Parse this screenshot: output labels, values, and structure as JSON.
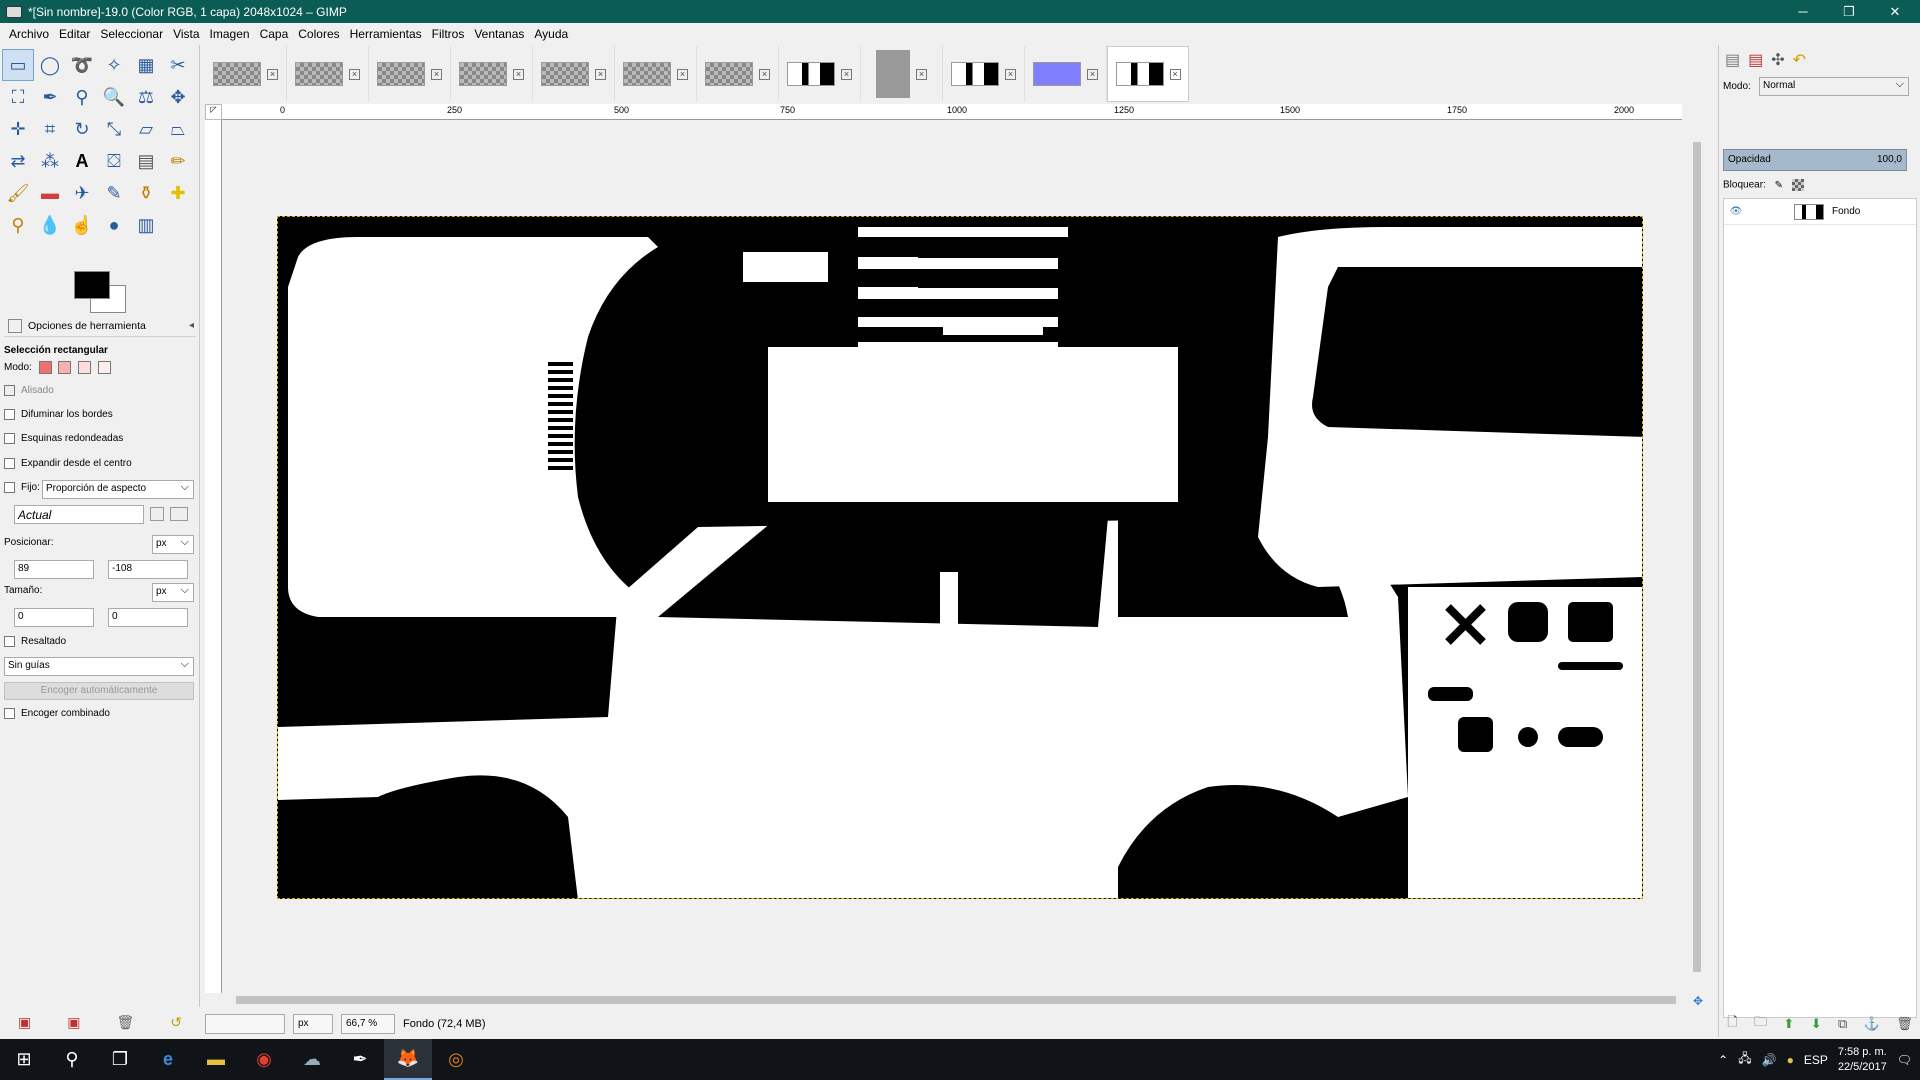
{
  "window": {
    "title": "*[Sin nombre]-19.0 (Color RGB, 1 capa) 2048x1024 – GIMP"
  },
  "menu": [
    "Archivo",
    "Editar",
    "Seleccionar",
    "Vista",
    "Imagen",
    "Capa",
    "Colores",
    "Herramientas",
    "Filtros",
    "Ventanas",
    "Ayuda"
  ],
  "tool_options": {
    "header": "Opciones de herramienta",
    "tool_name": "Selección rectangular",
    "mode_label": "Modo:",
    "antialias": "Alisado",
    "feather": "Difuminar los bordes",
    "rounded": "Esquinas redondeadas",
    "expand_center": "Expandir desde el centro",
    "fixed_label": "Fijo:",
    "fixed_value": "Proporción de aspecto",
    "current_value": "Actual",
    "position_label": "Posicionar:",
    "pos_unit": "px",
    "pos_x": "89",
    "pos_y": "-108",
    "size_label": "Tamaño:",
    "size_unit": "px",
    "size_w": "0",
    "size_h": "0",
    "highlight": "Resaltado",
    "guides": "Sin guías",
    "auto_shrink": "Encoger automáticamente",
    "shrink_merged": "Encoger combinado"
  },
  "ruler": {
    "h_labels": [
      "0",
      "250",
      "500",
      "750",
      "1000",
      "1250",
      "1500",
      "1750",
      "2000"
    ]
  },
  "status": {
    "unit": "px",
    "zoom": "66,7 %",
    "layer_info": "Fondo (72,4 MB)"
  },
  "layers_panel": {
    "mode_label": "Modo:",
    "mode_value": "Normal",
    "opacity_label": "Opacidad",
    "opacity_value": "100,0",
    "lock_label": "Bloquear:",
    "layers": [
      {
        "name": "Fondo"
      }
    ]
  },
  "taskbar": {
    "lang": "ESP",
    "time": "7:58 p. m.",
    "date": "22/5/2017"
  }
}
